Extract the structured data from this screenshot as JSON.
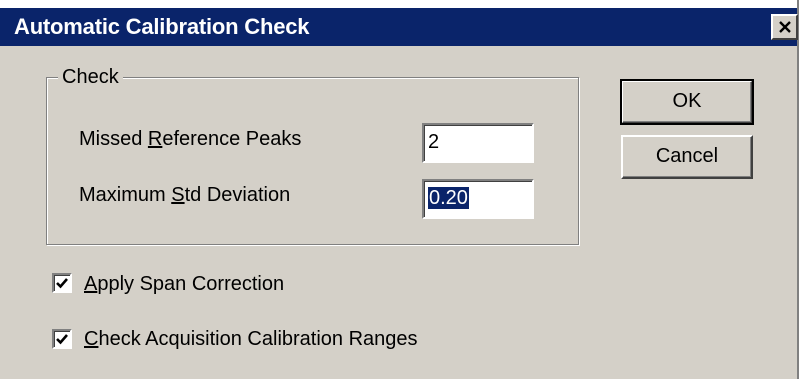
{
  "window": {
    "title": "Automatic Calibration Check",
    "close_glyph": "✕"
  },
  "check_group": {
    "legend": "Check",
    "missed_peaks": {
      "label_pre": "Missed ",
      "label_mnemonic": "R",
      "label_post": "eference Peaks",
      "value": "2"
    },
    "max_std_dev": {
      "label_pre": "Maximum ",
      "label_mnemonic": "S",
      "label_post": "td Deviation",
      "value": "0.20"
    }
  },
  "buttons": {
    "ok": "OK",
    "cancel": "Cancel"
  },
  "options": {
    "apply_span": {
      "mnemonic": "A",
      "label_rest": "pply Span Correction",
      "checked": true
    },
    "check_ranges": {
      "mnemonic": "C",
      "label_rest": "heck Acquisition Calibration Ranges",
      "checked": true
    }
  },
  "colors": {
    "titlebar": "#0a246a",
    "face": "#d4d0c8",
    "selection": "#0a246a"
  }
}
